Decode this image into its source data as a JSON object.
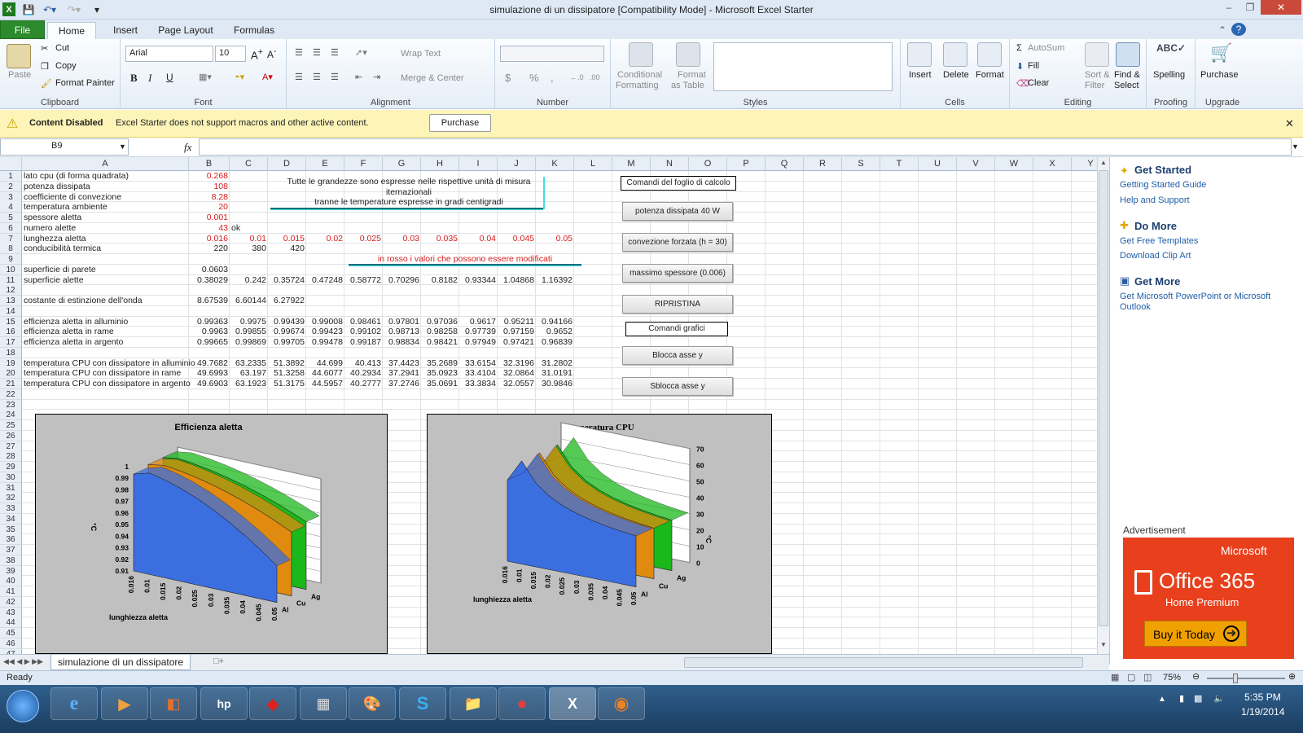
{
  "window": {
    "title": "simulazione di un dissipatore  [Compatibility Mode] - Microsoft Excel Starter",
    "minimize": "–",
    "restore": "❐",
    "close": "✕"
  },
  "ribbon_tabs": [
    "File",
    "Home",
    "Insert",
    "Page Layout",
    "Formulas"
  ],
  "ribbon": {
    "clipboard": {
      "paste": "Paste",
      "cut": "Cut",
      "copy": "Copy",
      "format_painter": "Format Painter",
      "label": "Clipboard"
    },
    "font": {
      "name": "Arial",
      "size": "10",
      "bold": "B",
      "italic": "I",
      "underline": "U",
      "label": "Font"
    },
    "alignment": {
      "wrap": "Wrap Text",
      "merge": "Merge & Center",
      "label": "Alignment"
    },
    "number": {
      "currency": "$",
      "percent": "%",
      "comma": ",",
      "label": "Number"
    },
    "styles": {
      "conditional": "Conditional",
      "conditional2": "Formatting",
      "format_table": "Format",
      "format_table2": "as Table",
      "label": "Styles"
    },
    "cells": {
      "insert": "Insert",
      "delete": "Delete",
      "format": "Format",
      "label": "Cells"
    },
    "editing": {
      "autosum": "AutoSum",
      "fill": "Fill",
      "clear": "Clear",
      "sort": "Sort &",
      "sort2": "Filter",
      "find": "Find &",
      "find2": "Select",
      "label": "Editing"
    },
    "proofing": {
      "spelling": "Spelling",
      "label": "Proofing"
    },
    "upgrade": {
      "purchase": "Purchase",
      "label": "Upgrade"
    }
  },
  "message_bar": {
    "title": "Content Disabled",
    "text": "Excel Starter does not support macros and other active content.",
    "button": "Purchase",
    "close": "✕"
  },
  "formula_bar": {
    "name_box": "B9",
    "fx": "fx",
    "content": ""
  },
  "columns": [
    "A",
    "B",
    "C",
    "D",
    "E",
    "F",
    "G",
    "H",
    "I",
    "J",
    "K",
    "L",
    "M",
    "N",
    "O",
    "P",
    "Q",
    "R",
    "S",
    "T",
    "U",
    "V",
    "W",
    "X",
    "Y"
  ],
  "rows": [
    "1",
    "2",
    "3",
    "4",
    "5",
    "6",
    "7",
    "8",
    "9",
    "10",
    "11",
    "12",
    "13",
    "14",
    "15",
    "16",
    "17",
    "18",
    "19",
    "20",
    "21",
    "22",
    "23",
    "24",
    "25",
    "26",
    "27",
    "28",
    "29",
    "30",
    "31",
    "32",
    "33",
    "34",
    "35",
    "36",
    "37",
    "38",
    "39",
    "40",
    "41",
    "42",
    "43",
    "44",
    "45",
    "46",
    "47"
  ],
  "cells": {
    "a1": "lato cpu (di forma quadrata)",
    "b1": "0.268",
    "a2": "potenza dissipata",
    "b2": "108",
    "a3": "coefficiente di convezione",
    "b3": "8.28",
    "a4": "temperatura ambiente",
    "b4": "20",
    "a5": "spessore aletta",
    "b5": "0.001",
    "a6": "numero alette",
    "b6": "43",
    "c6": "ok",
    "a7": "lunghezza aletta",
    "row7": [
      "0.016",
      "0.01",
      "0.015",
      "0.02",
      "0.025",
      "0.03",
      "0.035",
      "0.04",
      "0.045",
      "0.05"
    ],
    "a8": "conducibilità termica",
    "row8": [
      "220",
      "380",
      "420"
    ],
    "note1": "Tutte le grandezze sono espresse nelle rispettive unità di misura",
    "note2": "iternazionali",
    "note3": "tranne le temperature espresse in gradi centigradi",
    "note_red": "in rosso i valori che possono essere modificati",
    "a10": "superficie di parete",
    "b10": "0.0603",
    "a11": "superficie alette",
    "row11": [
      "0.38029",
      "0.242",
      "0.35724",
      "0.47248",
      "0.58772",
      "0.70296",
      "0.8182",
      "0.93344",
      "1.04868",
      "1.16392"
    ],
    "a13": "costante di estinzione dell'onda",
    "row13": [
      "8.67539",
      "6.60144",
      "6.27922"
    ],
    "a15": "efficienza aletta in alluminio",
    "row15": [
      "0.99363",
      "0.9975",
      "0.99439",
      "0.99008",
      "0.98461",
      "0.97801",
      "0.97036",
      "0.9617",
      "0.95211",
      "0.94166"
    ],
    "a16": "efficienza aletta in rame",
    "row16": [
      "0.9963",
      "0.99855",
      "0.99674",
      "0.99423",
      "0.99102",
      "0.98713",
      "0.98258",
      "0.97739",
      "0.97159",
      "0.9652"
    ],
    "a17": "efficienza aletta in argento",
    "row17": [
      "0.99665",
      "0.99869",
      "0.99705",
      "0.99478",
      "0.99187",
      "0.98834",
      "0.98421",
      "0.97949",
      "0.97421",
      "0.96839"
    ],
    "a19": "temperatura CPU con dissipatore in alluminio",
    "row19": [
      "49.7682",
      "63.2335",
      "51.3892",
      "44.699",
      "40.413",
      "37.4423",
      "35.2689",
      "33.6154",
      "32.3196",
      "31.2802"
    ],
    "a20": "temperatura CPU con dissipatore in rame",
    "row20": [
      "49.6993",
      "63.197",
      "51.3258",
      "44.6077",
      "40.2934",
      "37.2941",
      "35.0923",
      "33.4104",
      "32.0864",
      "31.0191"
    ],
    "a21": "temperatura CPU con dissipatore in argento",
    "row21": [
      "49.6903",
      "63.1923",
      "51.3175",
      "44.5957",
      "40.2777",
      "37.2746",
      "35.0691",
      "33.3834",
      "32.0557",
      "30.9846"
    ]
  },
  "buttons": {
    "header": "Comandi del foglio di calcolo",
    "b1": "potenza dissipata 40 W",
    "b2": "convezione forzata (h = 30)",
    "b3": "massimo spessore (0.006)",
    "b4": "RIPRISTINA",
    "b5": "Comandi grafici",
    "b6": "Blocca asse y",
    "b7": "Sblocca asse y"
  },
  "chart_data": [
    {
      "type": "area",
      "title": "Efficienza aletta",
      "xlabel": "lunghiezza aletta",
      "ylabel": "°C",
      "categories": [
        "0.016",
        "0.01",
        "0.015",
        "0.02",
        "0.025",
        "0.03",
        "0.035",
        "0.04",
        "0.045",
        "0.05"
      ],
      "series_labels": [
        "Al",
        "Cu",
        "Ag"
      ],
      "yticks": [
        "1",
        "0.99",
        "0.98",
        "0.97",
        "0.96",
        "0.95",
        "0.94",
        "0.93",
        "0.92",
        "0.91"
      ],
      "ylim": [
        0.91,
        1
      ],
      "series": [
        {
          "name": "Al",
          "values": [
            0.99363,
            0.9975,
            0.99439,
            0.99008,
            0.98461,
            0.97801,
            0.97036,
            0.9617,
            0.95211,
            0.94166
          ]
        },
        {
          "name": "Cu",
          "values": [
            0.9963,
            0.99855,
            0.99674,
            0.99423,
            0.99102,
            0.98713,
            0.98258,
            0.97739,
            0.97159,
            0.9652
          ]
        },
        {
          "name": "Ag",
          "values": [
            0.99665,
            0.99869,
            0.99705,
            0.99478,
            0.99187,
            0.98834,
            0.98421,
            0.97949,
            0.97421,
            0.96839
          ]
        }
      ],
      "colors": [
        "#3b6fe0",
        "#e08a10",
        "#1bb81b"
      ]
    },
    {
      "type": "area",
      "title": "Temperatura CPU",
      "xlabel": "lunghiezza aletta",
      "ylabel": "°C",
      "categories": [
        "0.016",
        "0.01",
        "0.015",
        "0.02",
        "0.025",
        "0.03",
        "0.035",
        "0.04",
        "0.045",
        "0.05"
      ],
      "series_labels": [
        "Al",
        "Cu",
        "Ag"
      ],
      "yticks": [
        "70",
        "60",
        "50",
        "40",
        "30",
        "20",
        "10",
        "0"
      ],
      "ylim": [
        0,
        70
      ],
      "series": [
        {
          "name": "Al",
          "values": [
            49.7682,
            63.2335,
            51.3892,
            44.699,
            40.413,
            37.4423,
            35.2689,
            33.6154,
            32.3196,
            31.2802
          ]
        },
        {
          "name": "Cu",
          "values": [
            49.6993,
            63.197,
            51.3258,
            44.6077,
            40.2934,
            37.2941,
            35.0923,
            33.4104,
            32.0864,
            31.0191
          ]
        },
        {
          "name": "Ag",
          "values": [
            49.6903,
            63.1923,
            51.3175,
            44.5957,
            40.2777,
            37.2746,
            35.0691,
            33.3834,
            32.0557,
            30.9846
          ]
        }
      ],
      "colors": [
        "#3b6fe0",
        "#e08a10",
        "#1bb81b"
      ]
    }
  ],
  "sheet_tab": "simulazione di un dissipatore",
  "task_pane": {
    "get_started": "Get Started",
    "guide": "Getting Started Guide",
    "help": "Help and Support",
    "do_more": "Do More",
    "templates": "Get Free Templates",
    "clipart": "Download Clip Art",
    "get_more": "Get More",
    "more_link": "Get Microsoft PowerPoint or Microsoft Outlook",
    "ad_label": "Advertisement",
    "ms": "Microsoft",
    "office": "Office 365",
    "premium": "Home Premium",
    "buy": "Buy it Today"
  },
  "status": {
    "ready": "Ready",
    "zoom": "75%"
  },
  "clock": {
    "time": "5:35 PM",
    "date": "1/19/2014"
  }
}
